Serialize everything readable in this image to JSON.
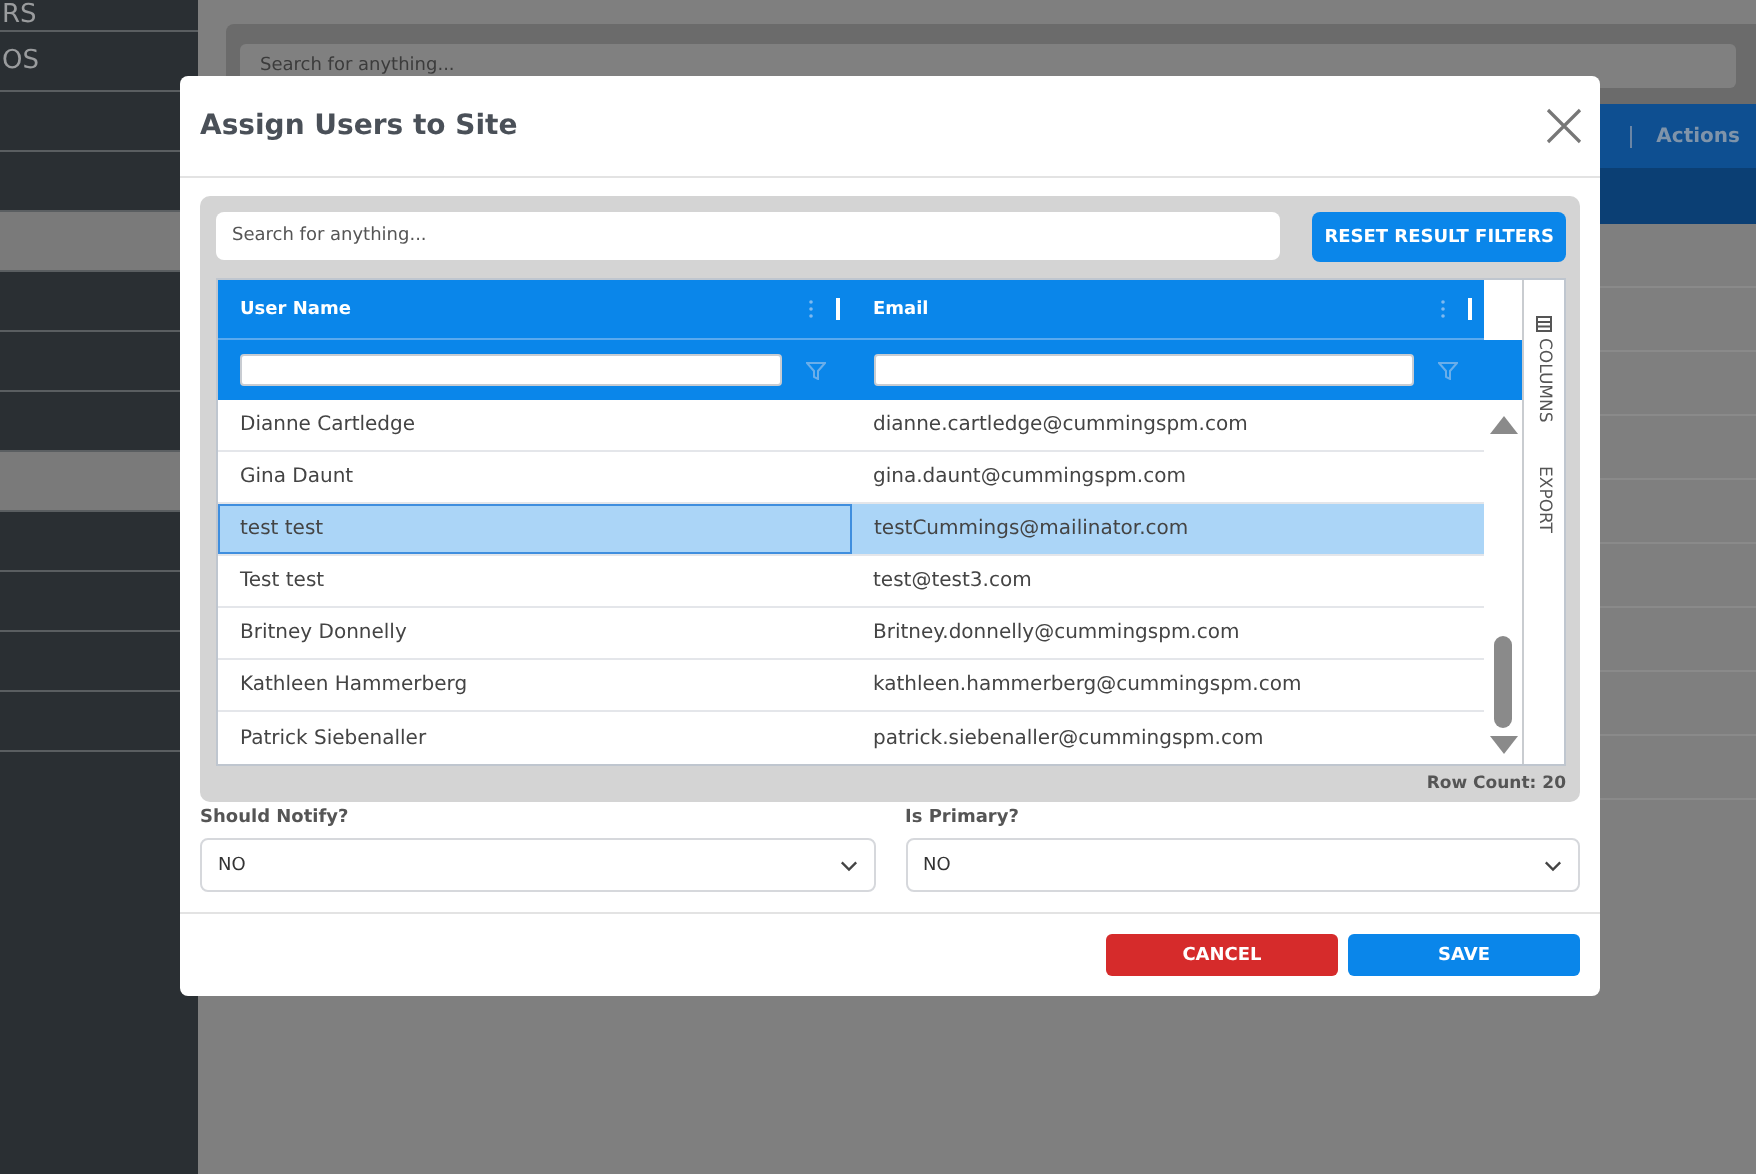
{
  "sidebar": {
    "items": [
      {
        "label": "RS"
      },
      {
        "label": "OS"
      }
    ]
  },
  "background": {
    "search": {
      "placeholder": "Search for anything..."
    },
    "table": {
      "columns": [
        "Actions"
      ]
    }
  },
  "dialog": {
    "title": "Assign Users to Site",
    "grid": {
      "search": {
        "placeholder": "Search for anything..."
      },
      "reset_button": "RESET RESULT FILTERS",
      "columns": [
        "User Name",
        "Email"
      ],
      "side_tabs": [
        "COLUMNS",
        "EXPORT"
      ],
      "rows": [
        {
          "user_name": "Dianne Cartledge",
          "email": "dianne.cartledge@cummingspm.com",
          "selected": false
        },
        {
          "user_name": "Gina Daunt",
          "email": "gina.daunt@cummingspm.com",
          "selected": false
        },
        {
          "user_name": "test test",
          "email": "testCummings@mailinator.com",
          "selected": true
        },
        {
          "user_name": "Test test",
          "email": "test@test3.com",
          "selected": false
        },
        {
          "user_name": "Britney Donnelly",
          "email": "Britney.donnelly@cummingspm.com",
          "selected": false
        },
        {
          "user_name": "Kathleen Hammerberg",
          "email": "kathleen.hammerberg@cummingspm.com",
          "selected": false
        },
        {
          "user_name": "Patrick Siebenaller",
          "email": "patrick.siebenaller@cummingspm.com",
          "selected": false
        }
      ],
      "row_count": "Row Count: 20"
    },
    "fields": [
      {
        "label": "Should Notify?",
        "value": "NO"
      },
      {
        "label": "Is Primary?",
        "value": "NO"
      }
    ],
    "buttons": [
      {
        "label": "CANCEL",
        "kind": "danger"
      },
      {
        "label": "SAVE",
        "kind": "primary"
      }
    ]
  }
}
